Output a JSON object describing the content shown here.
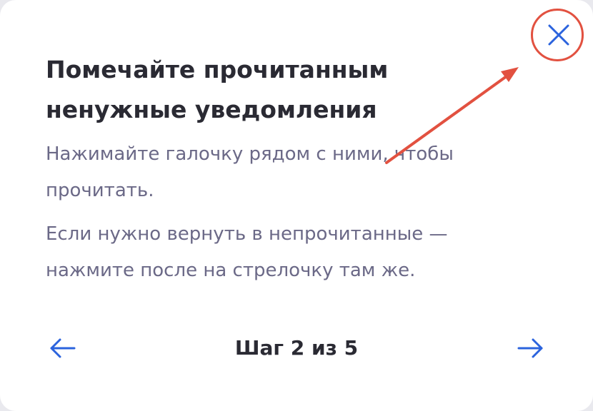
{
  "dialog": {
    "title": "Помечайте прочитанным ненужные уведомления",
    "paragraph_1": "Нажимайте галочку рядом с ними, чтобы прочитать.",
    "paragraph_2": "Если нужно вернуть в непрочитанные — нажмите после на стрелочку там же.",
    "step_indicator": "Шаг 2 из 5"
  },
  "icons": {
    "close": "close-icon",
    "previous": "arrow-left-icon",
    "next": "arrow-right-icon"
  },
  "colors": {
    "accent": "#2b63dd",
    "annotation": "#e25140",
    "title": "#2a2a33",
    "body_text": "#6b6987"
  }
}
